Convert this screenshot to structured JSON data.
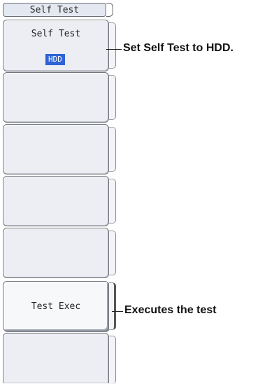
{
  "menu": {
    "title": "Self Test",
    "keys": [
      {
        "label": "Self Test",
        "value": "HDD"
      },
      {
        "label": ""
      },
      {
        "label": ""
      },
      {
        "label": ""
      },
      {
        "label": ""
      },
      {
        "label": "Test Exec"
      },
      {
        "label": ""
      }
    ]
  },
  "callouts": {
    "self_test": "Set Self Test to HDD.",
    "test_exec": "Executes the test"
  },
  "colors": {
    "value_highlight": "#2f63d6",
    "key_face": "#eceef4",
    "key_border": "#6f747c"
  }
}
